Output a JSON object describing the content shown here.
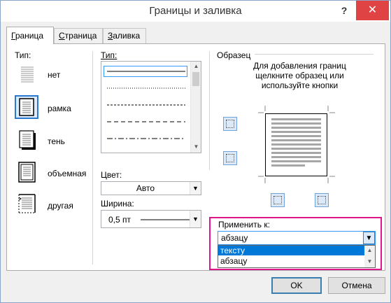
{
  "window": {
    "title": "Границы и заливка",
    "help": "?",
    "close": "✕"
  },
  "tabs": [
    {
      "label": "Граница",
      "underline": "Г",
      "rest": "раница"
    },
    {
      "label": "Страница",
      "underline": "С",
      "rest": "траница"
    },
    {
      "label": "Заливка",
      "underline": "З",
      "rest": "аливка"
    }
  ],
  "setting": {
    "label": "Тип:",
    "items": [
      {
        "label": "нет",
        "icon": "setting-none-icon"
      },
      {
        "label": "рамка",
        "icon": "setting-box-icon"
      },
      {
        "label": "тень",
        "icon": "setting-shadow-icon"
      },
      {
        "label": "объемная",
        "icon": "setting-3d-icon"
      },
      {
        "label": "другая",
        "icon": "setting-custom-icon"
      }
    ]
  },
  "style": {
    "label": "Тип:"
  },
  "color": {
    "label": "Цвет:",
    "value": "Авто"
  },
  "width": {
    "label": "Ширина:",
    "value": "0,5 пт"
  },
  "preview": {
    "label": "Образец",
    "instructions_line1": "Для добавления границ",
    "instructions_line2": "щелкните образец или",
    "instructions_line3": "используйте кнопки"
  },
  "apply": {
    "label": "Применить к:",
    "value": "абзацу",
    "options": [
      "тексту",
      "абзацу"
    ],
    "highlight_color": "#0078d7",
    "box_color": "#e0168c"
  },
  "buttons": {
    "ok": "OK",
    "cancel": "Отмена"
  }
}
